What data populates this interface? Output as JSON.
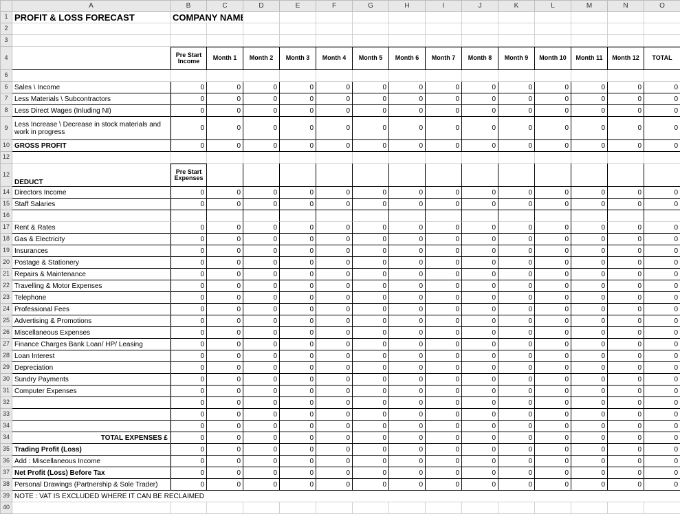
{
  "columns": [
    "",
    "A",
    "B",
    "C",
    "D",
    "E",
    "F",
    "G",
    "H",
    "I",
    "J",
    "K",
    "L",
    "M",
    "N",
    "O"
  ],
  "title": "PROFIT & LOSS FORECAST",
  "company_name_label": "COMPANY NAME:",
  "headers": {
    "pre_start_income": "Pre Start Income",
    "pre_start_expenses": "Pre Start Expenses",
    "months": [
      "Month 1",
      "Month 2",
      "Month 3",
      "Month 4",
      "Month 5",
      "Month 6",
      "Month 7",
      "Month 8",
      "Month 9",
      "Month 10",
      "Month 11",
      "Month 12"
    ],
    "total": "TOTAL"
  },
  "income_rows": [
    {
      "label": "Sales \\ Income",
      "values": [
        0,
        0,
        0,
        0,
        0,
        0,
        0,
        0,
        0,
        0,
        0,
        0,
        0,
        0
      ]
    },
    {
      "label": "Less Materials \\ Subcontractors",
      "values": [
        0,
        0,
        0,
        0,
        0,
        0,
        0,
        0,
        0,
        0,
        0,
        0,
        0,
        0
      ]
    },
    {
      "label": "Less Direct Wages (Inluding NI)",
      "values": [
        0,
        0,
        0,
        0,
        0,
        0,
        0,
        0,
        0,
        0,
        0,
        0,
        0,
        0
      ]
    },
    {
      "label": "Less Increase \\ Decrease in stock materials and work in progress",
      "values": [
        0,
        0,
        0,
        0,
        0,
        0,
        0,
        0,
        0,
        0,
        0,
        0,
        0,
        0
      ],
      "tall": true
    }
  ],
  "gross_profit": {
    "label": "GROSS PROFIT",
    "values": [
      0,
      0,
      0,
      0,
      0,
      0,
      0,
      0,
      0,
      0,
      0,
      0,
      0,
      0
    ]
  },
  "deduct_label": "DEDUCT",
  "expense_rows": [
    {
      "label": "Directors Income",
      "values": [
        0,
        0,
        0,
        0,
        0,
        0,
        0,
        0,
        0,
        0,
        0,
        0,
        0,
        0
      ]
    },
    {
      "label": "Staff Salaries",
      "values": [
        0,
        0,
        0,
        0,
        0,
        0,
        0,
        0,
        0,
        0,
        0,
        0,
        0,
        0
      ]
    },
    {
      "label": "",
      "blank": true
    },
    {
      "label": "Rent & Rates",
      "values": [
        0,
        0,
        0,
        0,
        0,
        0,
        0,
        0,
        0,
        0,
        0,
        0,
        0,
        0
      ]
    },
    {
      "label": "Gas & Electricity",
      "values": [
        0,
        0,
        0,
        0,
        0,
        0,
        0,
        0,
        0,
        0,
        0,
        0,
        0,
        0
      ]
    },
    {
      "label": "Insurances",
      "values": [
        0,
        0,
        0,
        0,
        0,
        0,
        0,
        0,
        0,
        0,
        0,
        0,
        0,
        0
      ]
    },
    {
      "label": "Postage & Stationery",
      "values": [
        0,
        0,
        0,
        0,
        0,
        0,
        0,
        0,
        0,
        0,
        0,
        0,
        0,
        0
      ]
    },
    {
      "label": "Repairs & Maintenance",
      "values": [
        0,
        0,
        0,
        0,
        0,
        0,
        0,
        0,
        0,
        0,
        0,
        0,
        0,
        0
      ]
    },
    {
      "label": "Travelling & Motor Expenses",
      "values": [
        0,
        0,
        0,
        0,
        0,
        0,
        0,
        0,
        0,
        0,
        0,
        0,
        0,
        0
      ]
    },
    {
      "label": "Telephone",
      "values": [
        0,
        0,
        0,
        0,
        0,
        0,
        0,
        0,
        0,
        0,
        0,
        0,
        0,
        0
      ]
    },
    {
      "label": "Professional Fees",
      "values": [
        0,
        0,
        0,
        0,
        0,
        0,
        0,
        0,
        0,
        0,
        0,
        0,
        0,
        0
      ]
    },
    {
      "label": "Advertising & Promotions",
      "values": [
        0,
        0,
        0,
        0,
        0,
        0,
        0,
        0,
        0,
        0,
        0,
        0,
        0,
        0
      ]
    },
    {
      "label": "Miscellaneous Expenses",
      "values": [
        0,
        0,
        0,
        0,
        0,
        0,
        0,
        0,
        0,
        0,
        0,
        0,
        0,
        0
      ]
    },
    {
      "label": "Finance Charges Bank Loan/ HP/ Leasing",
      "values": [
        0,
        0,
        0,
        0,
        0,
        0,
        0,
        0,
        0,
        0,
        0,
        0,
        0,
        0
      ]
    },
    {
      "label": "Loan Interest",
      "values": [
        0,
        0,
        0,
        0,
        0,
        0,
        0,
        0,
        0,
        0,
        0,
        0,
        0,
        0
      ]
    },
    {
      "label": "Depreciation",
      "values": [
        0,
        0,
        0,
        0,
        0,
        0,
        0,
        0,
        0,
        0,
        0,
        0,
        0,
        0
      ]
    },
    {
      "label": "Sundry Payments",
      "values": [
        0,
        0,
        0,
        0,
        0,
        0,
        0,
        0,
        0,
        0,
        0,
        0,
        0,
        0
      ]
    },
    {
      "label": "Computer Expenses",
      "values": [
        0,
        0,
        0,
        0,
        0,
        0,
        0,
        0,
        0,
        0,
        0,
        0,
        0,
        0
      ]
    },
    {
      "label": "",
      "values": [
        0,
        0,
        0,
        0,
        0,
        0,
        0,
        0,
        0,
        0,
        0,
        0,
        0,
        0
      ]
    },
    {
      "label": "",
      "values": [
        0,
        0,
        0,
        0,
        0,
        0,
        0,
        0,
        0,
        0,
        0,
        0,
        0,
        0
      ]
    },
    {
      "label": "",
      "values": [
        0,
        0,
        0,
        0,
        0,
        0,
        0,
        0,
        0,
        0,
        0,
        0,
        0,
        0
      ]
    }
  ],
  "totals": [
    {
      "label": "TOTAL EXPENSES £",
      "values": [
        0,
        0,
        0,
        0,
        0,
        0,
        0,
        0,
        0,
        0,
        0,
        0,
        0,
        0
      ],
      "right": true,
      "bold": true
    },
    {
      "label": "Trading Profit (Loss)",
      "values": [
        0,
        0,
        0,
        0,
        0,
        0,
        0,
        0,
        0,
        0,
        0,
        0,
        0,
        0
      ],
      "bold": true
    },
    {
      "label": "Add : Miscellaneous Income",
      "values": [
        0,
        0,
        0,
        0,
        0,
        0,
        0,
        0,
        0,
        0,
        0,
        0,
        0,
        0
      ]
    },
    {
      "label": "Net Profit (Loss) Before Tax",
      "values": [
        0,
        0,
        0,
        0,
        0,
        0,
        0,
        0,
        0,
        0,
        0,
        0,
        0,
        0
      ],
      "bold": true
    },
    {
      "label": "Personal Drawings (Partnership & Sole Trader)",
      "values": [
        0,
        0,
        0,
        0,
        0,
        0,
        0,
        0,
        0,
        0,
        0,
        0,
        0,
        0
      ]
    }
  ],
  "note": "NOTE : VAT IS EXCLUDED WHERE IT CAN BE RECLAIMED"
}
